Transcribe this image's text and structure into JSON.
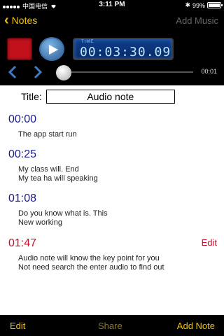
{
  "status_bar": {
    "carrier": "中国电信",
    "time": "3:11 PM",
    "battery": "99%"
  },
  "nav": {
    "back_label": "Notes",
    "right_label": "Add Music"
  },
  "player": {
    "timer_label": "TIME",
    "timer_value": "00:03:30.09",
    "duration": "00:01",
    "progress_fraction": 0
  },
  "title": {
    "label": "Title:",
    "value": "Audio note"
  },
  "notes": [
    {
      "time": "00:00",
      "text": "The app start run"
    },
    {
      "time": "00:25",
      "text": "My class will. End\nMy tea ha will speaking"
    },
    {
      "time": "01:08",
      "text": "Do you know what is. This\nNew working"
    },
    {
      "time": "01:47",
      "text": "Audio note will know the key point for you\nNot need search the enter audio to find out",
      "edit_label": "Edit"
    }
  ],
  "bottom_bar": {
    "edit": "Edit",
    "share": "Share",
    "add_note": "Add Note"
  },
  "colors": {
    "accent": "#f2c200",
    "active_time": "#c8102e",
    "time_text": "#1a1a8c"
  }
}
